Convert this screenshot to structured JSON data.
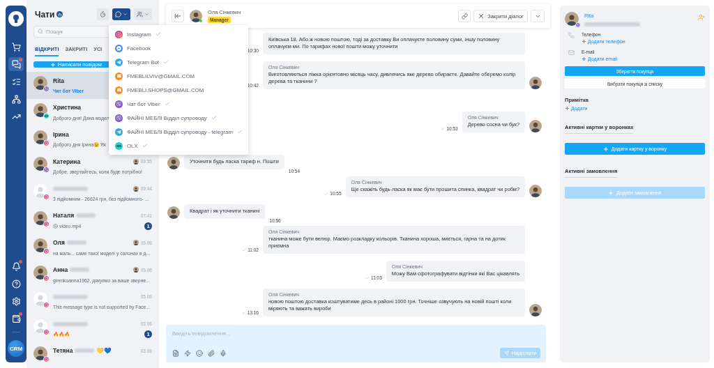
{
  "nav": {
    "logo_alert": false,
    "top": [
      {
        "kind": "cart",
        "selected": false,
        "alert": false
      },
      {
        "kind": "chats",
        "selected": true,
        "alert": true
      },
      {
        "kind": "tasks",
        "selected": false,
        "alert": false
      },
      {
        "kind": "structure",
        "selected": false,
        "alert": false
      },
      {
        "kind": "analytics",
        "selected": false,
        "alert": false
      }
    ],
    "bottom": [
      {
        "kind": "bell",
        "selected": false,
        "alert": true
      },
      {
        "kind": "help",
        "selected": false,
        "alert": false
      },
      {
        "kind": "settings",
        "selected": false,
        "alert": false
      },
      {
        "kind": "wallet",
        "selected": false,
        "alert": true
      }
    ],
    "brand": "CRM"
  },
  "chat_list": {
    "title": "Чати",
    "filter_buttons": [
      {
        "kind": "timer",
        "selected": false
      },
      {
        "kind": "channels",
        "selected": true
      },
      {
        "kind": "users",
        "selected": false
      }
    ],
    "search": {
      "placeholder": "Пошук"
    },
    "tabs": [
      {
        "label": "ВІДКРИТІ",
        "selected": true
      },
      {
        "label": "ЗАКРИТІ",
        "selected": false
      },
      {
        "label": "УСІ",
        "selected": false
      }
    ],
    "new_message_button": "Написати повідом",
    "chats": [
      {
        "kind": "viber",
        "name": "Rita",
        "has_photo": true,
        "name_hidden": false,
        "assignee": false,
        "preview": "Чат бот Viber",
        "channel_note": true,
        "attachment": false,
        "selected": true
      },
      {
        "kind": "olx",
        "name": "Христина",
        "has_photo": true,
        "name_hidden": false,
        "assignee": false,
        "preview": "Доброго дня! Дана модел",
        "channel_note": false,
        "attachment": false,
        "selected": false
      },
      {
        "kind": "instagram",
        "name": "Ірина",
        "has_photo": true,
        "name_hidden": false,
        "assignee": false,
        "preview": "Доброго дня Ірина😉 Як",
        "channel_note": false,
        "attachment": false,
        "selected": false
      },
      {
        "kind": "viber",
        "name": "Катерина",
        "has_photo": true,
        "name_hidden": false,
        "assignee": true,
        "time": "09:55",
        "preview": "Добре, звертайтесь, коли буде потрібно!",
        "channel_note": false,
        "attachment": false,
        "selected": false
      },
      {
        "kind": "instagram",
        "has_photo": false,
        "name_hidden": true,
        "assignee": true,
        "time": "09:44",
        "preview": "3 підйомним - 26624 грн, без підйомного- ...",
        "channel_note": false,
        "attachment": false,
        "selected": false
      },
      {
        "kind": "instagram",
        "name": "Наталя",
        "has_photo": true,
        "name_hidden": true,
        "assignee": false,
        "time": "07:41",
        "preview": "video.mp4",
        "channel_note": false,
        "attachment": true,
        "unread": "1",
        "selected": false
      },
      {
        "kind": "instagram",
        "name": "Оля",
        "has_photo": true,
        "name_hidden": true,
        "assignee": true,
        "time": "05.06",
        "preview": "на жаль... саме такої моделі у салонах в д...",
        "channel_note": false,
        "attachment": false,
        "selected": false
      },
      {
        "kind": "instagram",
        "name": "Анна",
        "has_photo": true,
        "name_hidden": true,
        "assignee": true,
        "time": "05.06",
        "preview": "girenkoanna1962, дякуємо за ваше зверне...",
        "channel_note": false,
        "attachment": false,
        "selected": false
      },
      {
        "kind": "instagram",
        "has_photo": false,
        "name_hidden": true,
        "assignee": false,
        "time": "05.06",
        "preview": "This message type is not supported by Face...",
        "channel_note": false,
        "attachment": false,
        "selected": false
      },
      {
        "kind": "instagram",
        "has_photo": false,
        "name_hidden": true,
        "assignee": false,
        "time": "03.06",
        "preview": "🔥🔥🔥",
        "channel_note": false,
        "attachment": false,
        "unread": "1",
        "selected": false
      },
      {
        "kind": "instagram",
        "name": "Тетяна",
        "name_suffix": "💛💙",
        "has_photo": true,
        "name_hidden": true,
        "assignee": false,
        "time": "03.06",
        "selected": false
      }
    ]
  },
  "channel_menu": {
    "items": [
      {
        "kind": "instagram",
        "label": "Instagram",
        "checked": true
      },
      {
        "kind": "messenger",
        "label": "Facebook",
        "checked": false
      },
      {
        "kind": "telegram",
        "label": "Telegram Bot",
        "checked": true
      },
      {
        "kind": "email",
        "label": "FMEBLILVIV@GMAIL.COM",
        "checked": false
      },
      {
        "kind": "email",
        "label": "FMEBLI.SHOPS@GMAIL.COM",
        "checked": false
      },
      {
        "kind": "viber",
        "label": "Чат бот Viber",
        "checked": true
      },
      {
        "kind": "viber",
        "label": "ФАЙНІ МЕБЛІ Відділ супроводу",
        "checked": true
      },
      {
        "kind": "telegram",
        "label": "ФАЙНІ МЕБЛІ Відділ супроводу - telegram",
        "checked": true
      },
      {
        "kind": "olx",
        "label": "OLX",
        "checked": true
      }
    ]
  },
  "dialog": {
    "contact": {
      "name": "Оля Сінкевич",
      "role": "Manager",
      "online": true
    },
    "close_button": "Закрити діалог",
    "messages": [
      {
        "outgoing": true,
        "text": "Київська 18. Або ж новою поштою, тоді за доставку Ви оплачуєте половину суми, іншу половину оплачуєм ми. По тарифах нової пошти можу уточнити",
        "time": "10:30",
        "checked": false,
        "avatar": false
      },
      {
        "outgoing": true,
        "sender": "Оля Сінкевич",
        "text": "Виготовляються ліжка орієнтовно місяць часу, дивлячись яке дерево обираєте. Давайте оберемо колір дерева та тканини ?",
        "time": "10:42",
        "checked": false,
        "avatar": true
      },
      {
        "outgoing": true,
        "sender": "Оля Сінкевич",
        "text": "Дерево сосна чи бук?",
        "time": "10:53",
        "checked": true,
        "avatar": true
      },
      {
        "outgoing": false,
        "text": "Уточнити будь ласка тариф н. Пошти",
        "time": "10:54",
        "checked": false,
        "avatar": true
      },
      {
        "outgoing": true,
        "sender": "Оля Сінкевич",
        "text": "Ще скажіть будь-ласка як має бути прошита спинка, квадрат чи робм?",
        "time": "10:55",
        "checked": true,
        "avatar": true
      },
      {
        "outgoing": false,
        "text": "Квадрат і як уточнити тканині",
        "time": "10:56",
        "checked": false,
        "avatar": true
      },
      {
        "outgoing": true,
        "sender": "Оля Сінкевич",
        "text": "тканина може бути велюр. Маємо розкладку кольорів. Тканина хороша, миється, гарна та на дотик приємна",
        "time": "11:02",
        "checked": true,
        "avatar": false
      },
      {
        "outgoing": true,
        "sender": "Оля Сінкевич",
        "text": "Можу Вам сфотографувати відтінки які Вас цікавлять",
        "time": "11:03",
        "checked": true,
        "avatar": false
      },
      {
        "outgoing": true,
        "sender": "Оля Сінкевич",
        "text": "новою поштою доставка коштуватиме десь в районі 1000 грн. Точніше озвучують на новій пошті коли міряють та важать вироби",
        "time": "13:16",
        "checked": true,
        "avatar": true
      }
    ],
    "composer": {
      "placeholder": "Введіть повідомлення...",
      "send_button": {
        "label": "Надіслати",
        "disabled": true
      }
    }
  },
  "customer": {
    "name": "Rita",
    "channel_badge": {
      "kind": "viber"
    },
    "detail_hidden": true,
    "phone_label": "Телефон",
    "add_phone": "Додати телефон",
    "email_label": "E-mail",
    "add_email": "Додати email",
    "save_button": "Зберегти покупця",
    "pick_button": "Вибрати покупця зі списку",
    "note_title": "Примітка",
    "add_note": "Додати",
    "cards_title": "Активні картки у воронках",
    "add_card_button": {
      "label": "Додати картку у воронку",
      "disabled": false
    },
    "orders_title": "Активні замовлення",
    "add_order_button": {
      "label": "Додати замовлення",
      "disabled": true
    }
  }
}
